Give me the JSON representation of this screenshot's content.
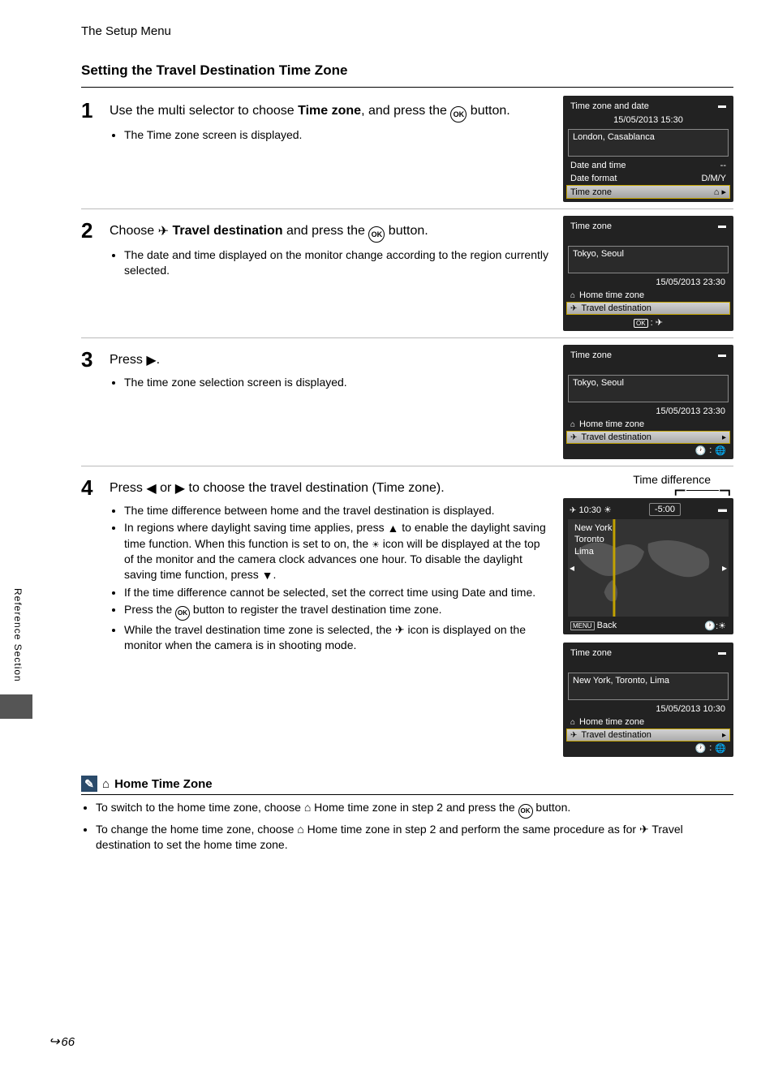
{
  "header": "The Setup Menu",
  "section_title": "Setting the Travel Destination Time Zone",
  "side_tab": "Reference Section",
  "page_number": "66",
  "steps": {
    "1": {
      "instruction_pre": "Use the multi selector to choose ",
      "instruction_bold": "Time zone",
      "instruction_post": ", and press the ",
      "instruction_end": " button.",
      "bullet1_a": "The ",
      "bullet1_bold": "Time zone",
      "bullet1_b": " screen is displayed."
    },
    "2": {
      "instr_a": "Choose ",
      "instr_bold": "Travel destination",
      "instr_b": " and press the ",
      "instr_end": " button.",
      "bullet1": "The date and time displayed on the monitor change according to the region currently selected."
    },
    "3": {
      "instr_a": "Press ",
      "instr_end": ".",
      "bullet1": "The time zone selection screen is displayed."
    },
    "4": {
      "instr_a": "Press ",
      "instr_mid": " or ",
      "instr_b": " to choose the travel destination (Time zone).",
      "b1": "The time difference between home and the travel destination is displayed.",
      "b2_a": "In regions where daylight saving time applies, press ",
      "b2_b": " to enable the daylight saving time function. When this function is set to on, the ",
      "b2_c": " icon will be displayed at the top of the monitor and the camera clock advances one hour. To disable the daylight saving time function, press ",
      "b2_d": ".",
      "b3_a": "If the time difference cannot be selected, set the correct time using ",
      "b3_bold": "Date and time",
      "b3_b": ".",
      "b4_a": "Press the ",
      "b4_b": " button to register the travel destination time zone.",
      "b5_a": "While the travel destination time zone is selected, the ",
      "b5_b": " icon is displayed on the monitor when the camera is in shooting mode."
    }
  },
  "note": {
    "title": "Home Time Zone",
    "li1_a": "To switch to the home time zone, choose ",
    "li1_bold": "Home time zone",
    "li1_b": " in step 2 and press the ",
    "li1_c": " button.",
    "li2_a": "To change the home time zone, choose ",
    "li2_bold1": "Home time zone",
    "li2_b": " in step 2 and perform the same procedure as for ",
    "li2_bold2": "Travel destination",
    "li2_c": " to set the home time zone."
  },
  "screens": {
    "s1": {
      "title": "Time zone and date",
      "datetime": "15/05/2013  15:30",
      "zone": "London, Casablanca",
      "row1": "Date and time",
      "row1v": "--",
      "row2": "Date format",
      "row2v": "D/M/Y",
      "row3": "Time zone"
    },
    "s2": {
      "title": "Time zone",
      "zone": "Tokyo, Seoul",
      "datetime": "15/05/2013  23:30",
      "opt1": "Home time zone",
      "opt2": "Travel destination"
    },
    "s3": {
      "title": "Time zone",
      "zone": "Tokyo, Seoul",
      "datetime": "15/05/2013  23:30",
      "opt1": "Home time zone",
      "opt2": "Travel destination"
    },
    "s4map": {
      "time": "10:30",
      "diff": "-5:00",
      "city1": "New York",
      "city2": "Toronto",
      "city3": "Lima",
      "back": "Back"
    },
    "s4b": {
      "title": "Time zone",
      "zone": "New York, Toronto, Lima",
      "datetime": "15/05/2013  10:30",
      "opt1": "Home time zone",
      "opt2": "Travel destination"
    },
    "timediff_label": "Time difference"
  }
}
